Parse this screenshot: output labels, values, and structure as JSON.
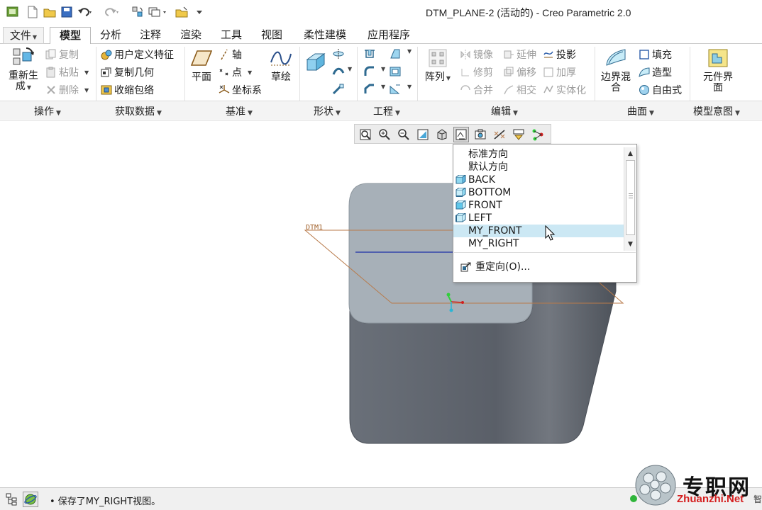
{
  "window": {
    "title": "DTM_PLANE-2 (活动的) - Creo Parametric 2.0"
  },
  "quick_access": {
    "icons": [
      "app-logo-icon",
      "new-file-icon",
      "open-folder-icon",
      "save-icon",
      "undo-icon",
      "redo-icon",
      "regenerate-icon",
      "windows-icon",
      "close-window-icon",
      "customize-toolbar-icon"
    ]
  },
  "tabs": [
    {
      "label": "文件",
      "id": "file"
    },
    {
      "label": "模型",
      "id": "model",
      "active": true
    },
    {
      "label": "分析",
      "id": "analysis"
    },
    {
      "label": "注释",
      "id": "annotate"
    },
    {
      "label": "渲染",
      "id": "render"
    },
    {
      "label": "工具",
      "id": "tools"
    },
    {
      "label": "视图",
      "id": "view"
    },
    {
      "label": "柔性建模",
      "id": "flexible-modeling"
    },
    {
      "label": "应用程序",
      "id": "applications"
    }
  ],
  "ribbon": {
    "operations": {
      "group_label": "操作",
      "regenerate_label_1": "重新生",
      "regenerate_label_2": "成",
      "copy": "复制",
      "paste": "粘贴",
      "delete": "删除"
    },
    "get_data": {
      "group_label": "获取数据",
      "udf": "用户定义特征",
      "copy_geom": "复制几何",
      "shrinkwrap": "收缩包络"
    },
    "datum": {
      "group_label": "基准",
      "plane": "平面",
      "axis": "轴",
      "point": "点",
      "csys": "坐标系",
      "sketch": "草绘"
    },
    "shapes": {
      "group_label": "形状"
    },
    "engineering": {
      "group_label": "工程"
    },
    "editing": {
      "group_label": "编辑",
      "pattern": "阵列",
      "mirror": "镜像",
      "trim": "修剪",
      "merge": "合并",
      "extend": "延伸",
      "offset": "偏移",
      "intersect": "相交",
      "project": "投影",
      "thicken": "加厚",
      "solidify": "实体化"
    },
    "surfaces": {
      "group_label": "曲面",
      "boundary_blend_1": "边界混",
      "boundary_blend_2": "合",
      "fill": "填充",
      "style": "造型",
      "freestyle": "自由式"
    },
    "model_intent": {
      "group_label": "模型意图",
      "component_interface_1": "元件界",
      "component_interface_2": "面"
    }
  },
  "view_toolbar": {
    "icons": [
      "refit-icon",
      "zoom-in-icon",
      "zoom-out-icon",
      "repaint-icon",
      "display-style-icon",
      "saved-orientations-icon",
      "view-manager-icon",
      "datum-display-icon",
      "annotation-display-icon",
      "spin-center-icon"
    ]
  },
  "orientation_dropdown": {
    "items": [
      "标准方向",
      "默认方向",
      "BACK",
      "BOTTOM",
      "FRONT",
      "LEFT",
      "MY_FRONT",
      "MY_RIGHT"
    ],
    "highlighted": "MY_FRONT",
    "reorient": "重定向(O)..."
  },
  "model": {
    "datum_plane_tag": "DTM1",
    "top_face_color": "#a7b0b8",
    "side_face_color": "#5b6069",
    "datum_plane_color": "#b87a4a"
  },
  "status": {
    "message": "• 保存了MY_RIGHT视图。"
  },
  "watermark": {
    "brand": "专职网",
    "url": "Zhuanzhi.Net",
    "trailing_char": "智"
  }
}
